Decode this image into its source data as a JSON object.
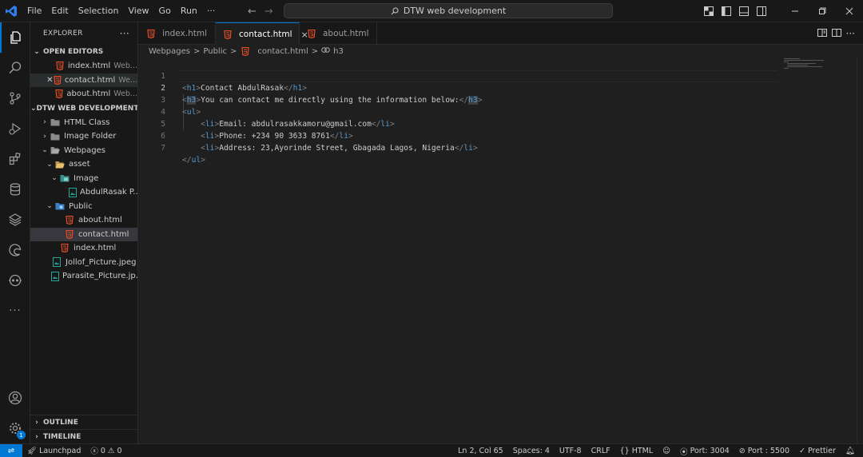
{
  "titlebar": {
    "menu": [
      "File",
      "Edit",
      "Selection",
      "View",
      "Go",
      "Run",
      "···"
    ],
    "search_text": "DTW web development"
  },
  "sidebar": {
    "title": "EXPLORER",
    "more": "···",
    "open_editors": {
      "label": "OPEN EDITORS",
      "items": [
        {
          "name": "index.html",
          "desc": "Web..."
        },
        {
          "name": "contact.html",
          "desc": "We..."
        },
        {
          "name": "about.html",
          "desc": "Web..."
        }
      ]
    },
    "project": {
      "label": "DTW WEB DEVELOPMENT",
      "items": [
        {
          "name": "HTML Class"
        },
        {
          "name": "Image Folder"
        },
        {
          "name": "Webpages"
        },
        {
          "name": "asset"
        },
        {
          "name": "Image"
        },
        {
          "name": "AbdulRasak P..."
        },
        {
          "name": "Public"
        },
        {
          "name": "about.html"
        },
        {
          "name": "contact.html"
        },
        {
          "name": "index.html"
        },
        {
          "name": "Jollof_Picture.jpeg"
        },
        {
          "name": "Parasite_Picture.jp..."
        }
      ]
    },
    "outline": "OUTLINE",
    "timeline": "TIMELINE"
  },
  "tabs": [
    {
      "label": "index.html"
    },
    {
      "label": "contact.html",
      "close": "×"
    },
    {
      "label": "about.html"
    }
  ],
  "breadcrumb": {
    "parts": [
      "Webpages",
      ">",
      "Public",
      ">",
      "contact.html",
      ">",
      "h3"
    ]
  },
  "editor": {
    "line_numbers": [
      "1",
      "2",
      "3",
      "4",
      "5",
      "6",
      "7"
    ],
    "lines": [
      {
        "indent": "",
        "open": "h1",
        "text": "Contact AbdulRasak",
        "close": "h1"
      },
      {
        "indent": "",
        "open": "h3",
        "text": "You can contact me directly using the information below:",
        "close": "h3"
      },
      {
        "indent": "",
        "open": "ul",
        "text": "",
        "close": ""
      },
      {
        "indent": "    ",
        "open": "li",
        "text": "Email: abdulrasakkamoru@gmail.com",
        "close": "li"
      },
      {
        "indent": "    ",
        "open": "li",
        "text": "Phone: +234 90 3633 8761",
        "close": "li"
      },
      {
        "indent": "    ",
        "open": "li",
        "text": "Address: 23,Ayorinde Street, Gbagada Lagos, Nigeria",
        "close": "li"
      },
      {
        "indent": "",
        "open": "",
        "text": "",
        "close": "ul"
      }
    ]
  },
  "statusbar": {
    "launchpad": "Launchpad",
    "errors": "0",
    "warnings": "0",
    "position": "Ln 2, Col 65",
    "spaces": "Spaces: 4",
    "encoding": "UTF-8",
    "eol": "CRLF",
    "language": "HTML",
    "port1": "Port: 3004",
    "port2": "Port : 5500",
    "prettier": "Prettier"
  },
  "activity_badge": "1",
  "colors": {
    "accent": "#0078d4",
    "tag": "#569cd6",
    "bracket": "#808080",
    "html_icon": "#e44d26"
  }
}
